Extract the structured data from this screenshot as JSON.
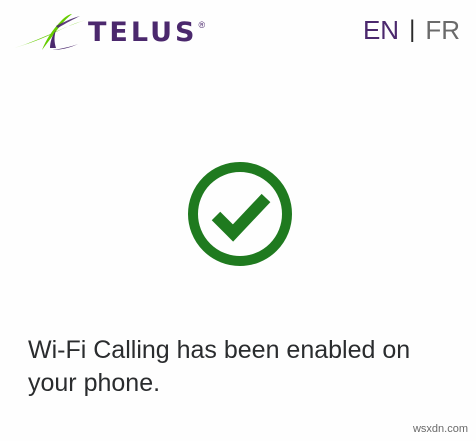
{
  "brand": {
    "name": "TELUS",
    "registered": "®",
    "color": "#4b286d",
    "accent": "#66cc00"
  },
  "language": {
    "active": "EN",
    "separator": "|",
    "inactive": "FR"
  },
  "status": {
    "icon": "check-circle-icon",
    "color": "#1f7a1f",
    "message": "Wi-Fi Calling has been enabled on your phone."
  },
  "watermark": "wsxdn.com"
}
